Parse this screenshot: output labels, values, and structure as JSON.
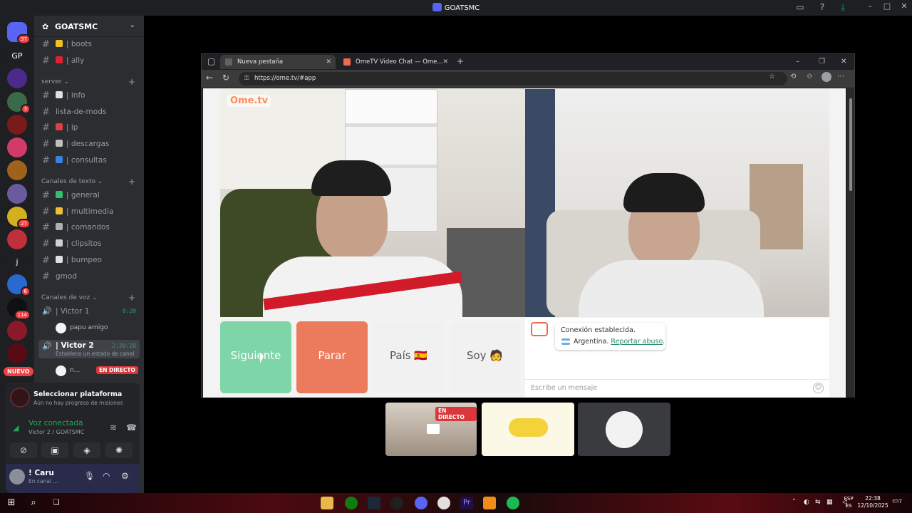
{
  "window": {
    "title": "GOATSMC"
  },
  "servers": [
    {
      "label": "",
      "badge": "37",
      "color": "#5865f2"
    },
    {
      "label": "GP",
      "badge": "",
      "color": "#1e1f22"
    },
    {
      "label": "",
      "badge": "",
      "color": "#4b2a8a"
    },
    {
      "label": "",
      "badge": "3",
      "color": "#3a6a4a"
    },
    {
      "label": "",
      "badge": "",
      "color": "#7a1a1a"
    },
    {
      "label": "",
      "badge": "",
      "color": "#d23a6a"
    },
    {
      "label": "",
      "badge": "",
      "color": "#a0621a"
    },
    {
      "label": "",
      "badge": "",
      "color": "#6a5aa0"
    },
    {
      "label": "",
      "badge": "27",
      "color": "#d4b020"
    },
    {
      "label": "",
      "badge": "",
      "color": "#c0303a"
    },
    {
      "label": "j",
      "badge": "",
      "color": "#1e1f22"
    },
    {
      "label": "",
      "badge": "6",
      "color": "#2a6ad0"
    },
    {
      "label": "",
      "badge": "114",
      "color": "#101010"
    },
    {
      "label": "",
      "badge": "",
      "color": "#8a1a2a"
    },
    {
      "label": "",
      "badge": "",
      "color": "#5a0a14"
    }
  ],
  "new_badge": "NUEVO",
  "guild": {
    "name": "GOATSMC"
  },
  "channels_top": [
    {
      "emoji_color": "#f0c020",
      "label": "| boots"
    },
    {
      "emoji_color": "#e02030",
      "label": "| ally"
    }
  ],
  "cat_server": "server",
  "channels_server": [
    {
      "emoji_color": "#e0e0e0",
      "label": "| info",
      "plain": false
    },
    {
      "emoji_color": "",
      "label": "lista-de-mods",
      "plain": true
    },
    {
      "emoji_color": "#e04040",
      "label": "| ip",
      "plain": false
    },
    {
      "emoji_color": "#c0c0c0",
      "label": "| descargas",
      "plain": false
    },
    {
      "emoji_color": "#3a80e0",
      "label": "| consultas",
      "plain": false
    }
  ],
  "cat_text": "Canales de texto",
  "channels_text": [
    {
      "emoji_color": "#30c070",
      "label": "| general",
      "plain": false
    },
    {
      "emoji_color": "#f0c030",
      "label": "| multimedia",
      "plain": false
    },
    {
      "emoji_color": "#b0b0b0",
      "label": "| comandos",
      "plain": false
    },
    {
      "emoji_color": "#d0d0d0",
      "label": "| clipsitos",
      "plain": false
    },
    {
      "emoji_color": "#e0e0e0",
      "label": "| bumpeo",
      "plain": false
    },
    {
      "emoji_color": "",
      "label": "gmod",
      "plain": true
    }
  ],
  "cat_voice": "Canales de voz",
  "voice": [
    {
      "label": "| Victor 1",
      "time": "8:20",
      "sub": ""
    },
    {
      "label": "| Victor 2",
      "time": "2:20:28",
      "sub": "Establece un estado de canal"
    }
  ],
  "voice_users": [
    {
      "name": "papu amigo"
    },
    {
      "name": "n..."
    }
  ],
  "live_label": "EN DIRECTO",
  "quest": {
    "title": "Seleccionar plataforma",
    "sub": "Aún no hay progreso de misiones"
  },
  "voice_conn": {
    "title": "Voz conectada",
    "sub": "Victor 2 / GOATSMC"
  },
  "me": {
    "name": "! Caru",
    "status": "En canal ..."
  },
  "browser": {
    "tabs": [
      {
        "label": "Nueva pestaña",
        "active": true,
        "icon_color": "#5f6368"
      },
      {
        "label": "OmeTV Video Chat — Ome...",
        "active": false,
        "icon_color": "#f06a4f"
      }
    ],
    "url": "https://ome.tv/#app"
  },
  "ome": {
    "logo": "Ome.tv",
    "buttons": [
      {
        "label": "Siguiente",
        "bg": "#7ed6a8"
      },
      {
        "label": "Parar",
        "bg": "#ec7a5c"
      },
      {
        "label": "País 🇪🇸",
        "bg": "#f1f1f1"
      },
      {
        "label": "Soy 🧑",
        "bg": "#f1f1f1"
      }
    ],
    "msg1": "Conexión establecida.",
    "msg2_country": "Argentina.",
    "msg2_link": "Reportar abuso",
    "msg2_end": ".",
    "placeholder": "Escribe un mensaje"
  },
  "taskbar": {
    "lang": "ESP",
    "region": "ES",
    "time": "22:38",
    "date": "12/10/2025",
    "notif": "7"
  }
}
